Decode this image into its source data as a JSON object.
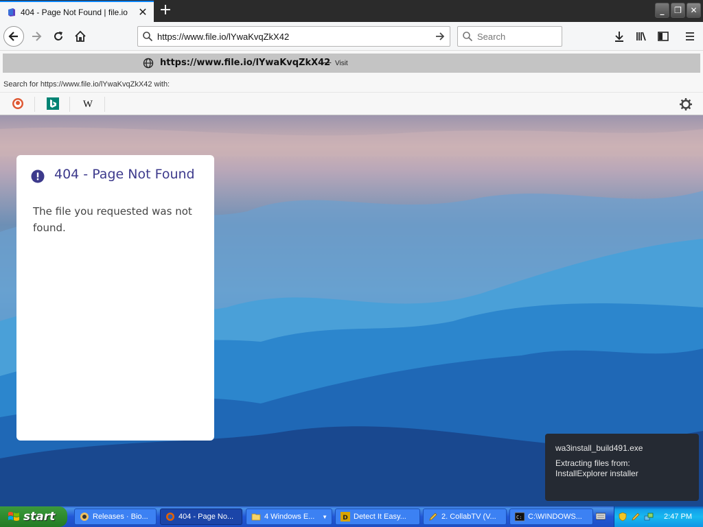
{
  "browser": {
    "tab": {
      "title": "404 - Page Not Found | file.io",
      "favicon": "file-io-icon"
    },
    "nav": {
      "url": "https://www.file.io/lYwaKvqZkX42",
      "search_placeholder": "Search"
    },
    "dropdown": {
      "suggestion_url": "https://www.file.io/lYwaKvqZkX42",
      "suggestion_dash": "—",
      "suggestion_action": "Visit",
      "search_with_prefix": "Search for ",
      "search_with_query": "https://www.file.io/lYwaKvqZkX42",
      "search_with_suffix": " with:",
      "engines": [
        "duckduckgo-icon",
        "bing-icon",
        "wikipedia-icon"
      ]
    }
  },
  "page": {
    "card_title": "404 - Page Not Found",
    "card_message": "The file you requested was not found.",
    "accent": "#3d3a8c"
  },
  "notification": {
    "title": "wa3install_build491.exe",
    "line1": "Extracting files from:",
    "line2": "InstallExplorer installer"
  },
  "taskbar": {
    "start_label": "start",
    "tasks": [
      {
        "label": "Releases · Bio...",
        "icon": "github-icon",
        "active": false
      },
      {
        "label": "404 - Page No...",
        "icon": "firefox-icon",
        "active": true
      },
      {
        "label": "4 Windows E...",
        "icon": "folder-icon",
        "active": false
      },
      {
        "label": "Detect It Easy...",
        "icon": "die-icon",
        "active": false
      },
      {
        "label": "2. CollabTV (V...",
        "icon": "pencil-icon",
        "active": false
      },
      {
        "label": "C:\\WINDOWS...",
        "icon": "cmd-icon",
        "active": false
      }
    ],
    "clock": "2:47 PM"
  }
}
